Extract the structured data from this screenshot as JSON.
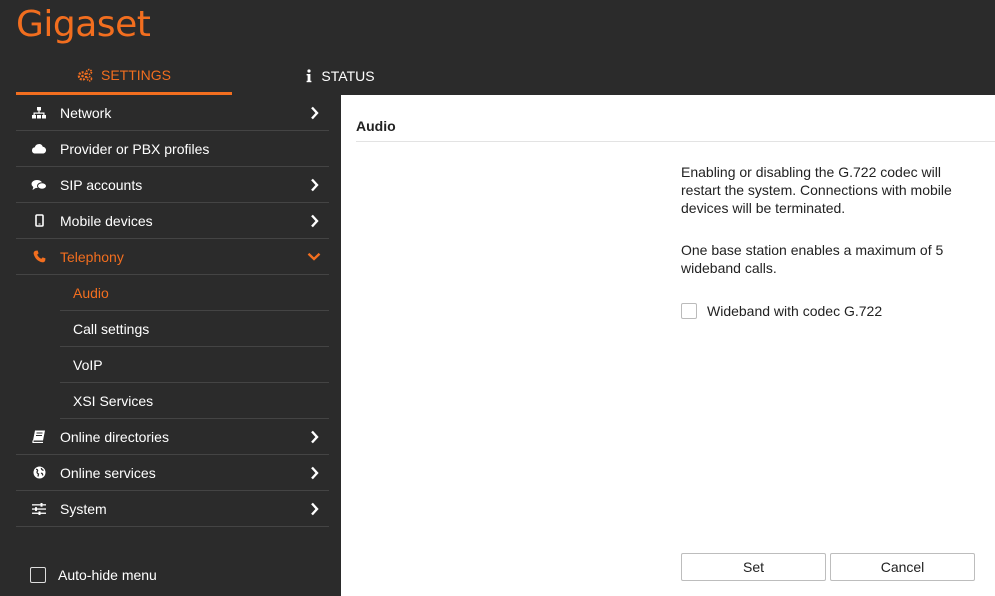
{
  "brand": {
    "logo_text": "Gigaset",
    "accent_color": "#f26e1f"
  },
  "tabs": [
    {
      "label": "SETTINGS",
      "icon": "gears-icon",
      "active": true
    },
    {
      "label": "STATUS",
      "icon": "info-icon",
      "active": false
    }
  ],
  "sidebar": {
    "items": [
      {
        "label": "Network",
        "icon": "network-icon",
        "chevron": "right"
      },
      {
        "label": "Provider or PBX profiles",
        "icon": "cloud-icon",
        "chevron": ""
      },
      {
        "label": "SIP accounts",
        "icon": "chat-icon",
        "chevron": "right"
      },
      {
        "label": "Mobile devices",
        "icon": "mobile-icon",
        "chevron": "right"
      },
      {
        "label": "Telephony",
        "icon": "phone-icon",
        "chevron": "down",
        "active": true
      },
      {
        "label": "Online directories",
        "icon": "book-icon",
        "chevron": "right"
      },
      {
        "label": "Online services",
        "icon": "globe-icon",
        "chevron": "right"
      },
      {
        "label": "System",
        "icon": "sliders-icon",
        "chevron": "right"
      }
    ],
    "telephony_sub": [
      {
        "label": "Audio",
        "active": true
      },
      {
        "label": "Call settings"
      },
      {
        "label": "VoIP"
      },
      {
        "label": "XSI Services"
      }
    ],
    "autohide_label": "Auto-hide menu"
  },
  "main": {
    "title": "Audio",
    "info1": "Enabling or disabling the G.722 codec will restart the system. Connections with mobile devices will be terminated.",
    "info2": "One base station enables a maximum of 5 wideband calls.",
    "checkbox_label": "Wideband with codec G.722",
    "checkbox_checked": false,
    "set_label": "Set",
    "cancel_label": "Cancel"
  }
}
